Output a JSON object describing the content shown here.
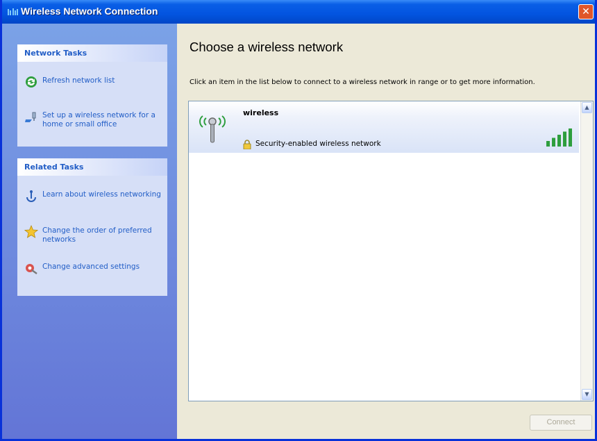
{
  "window": {
    "title": "Wireless Network Connection",
    "close_glyph": "✕",
    "colors": {
      "titlebar": "#0354e0",
      "close": "#e0562a",
      "sidebar": "#6f8fde",
      "panel": "#d6dff7",
      "link": "#215dc6"
    }
  },
  "sidebar": {
    "network_tasks": {
      "header": "Network Tasks",
      "items": [
        {
          "label": "Refresh network list",
          "icon": "refresh-icon"
        },
        {
          "label": "Set up a wireless network for a home or small office",
          "icon": "setup-wireless-icon"
        }
      ]
    },
    "related_tasks": {
      "header": "Related Tasks",
      "items": [
        {
          "label": "Learn about wireless networking",
          "icon": "info-icon"
        },
        {
          "label": "Change the order of preferred networks",
          "icon": "star-icon"
        },
        {
          "label": "Change advanced settings",
          "icon": "settings-icon"
        }
      ]
    }
  },
  "main": {
    "title": "Choose a wireless network",
    "instructions": "Click an item in the list below to connect to a wireless network in range or to get more information.",
    "networks": [
      {
        "name": "wireless",
        "security": "Security-enabled wireless network",
        "signal_bars": 5,
        "signal_max": 5
      }
    ],
    "connect_label": "Connect"
  }
}
